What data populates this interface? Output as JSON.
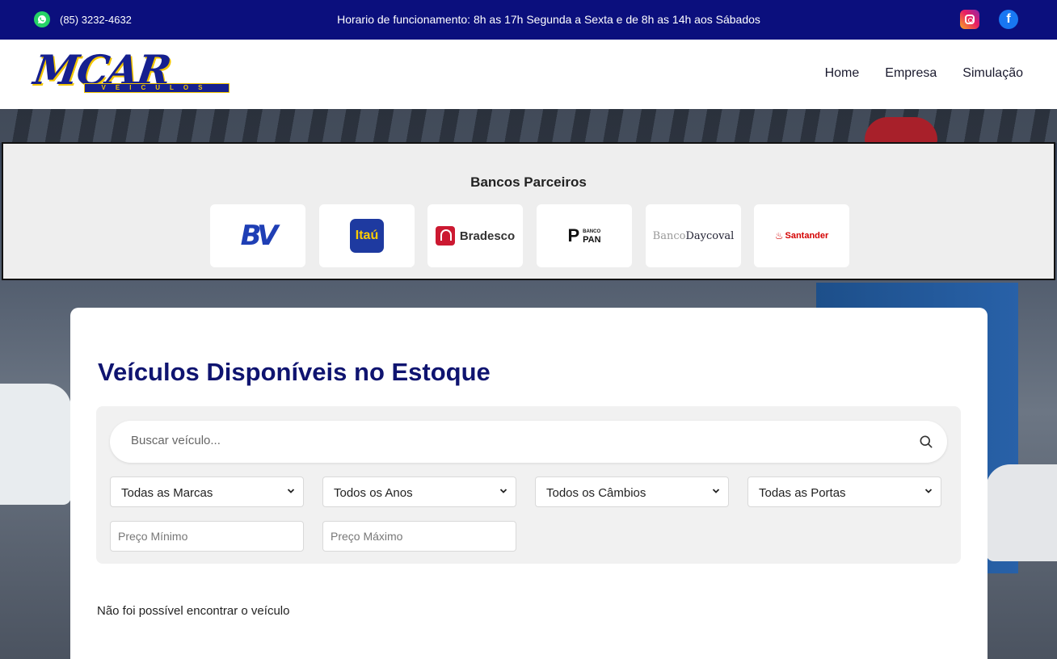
{
  "topbar": {
    "phone": "(85) 3232-4632",
    "hours": "Horario de funcionamento: 8h as 17h Segunda a Sexta e de 8h as 14h aos Sábados",
    "colors": {
      "background": "#0b0f7d",
      "whatsapp": "#25d366",
      "facebook": "#1877f2"
    },
    "icons": [
      "whatsapp-icon",
      "instagram-icon",
      "facebook-icon"
    ]
  },
  "header": {
    "logo": {
      "main": "MCAR",
      "sub": "VEICULOS"
    },
    "nav": [
      "Home",
      "Empresa",
      "Simulação"
    ]
  },
  "banks": {
    "title": "Bancos Parceiros",
    "items": [
      {
        "name": "BV",
        "logo": "bv-logo"
      },
      {
        "name": "Itaú",
        "logo": "itau-logo"
      },
      {
        "name": "Bradesco",
        "logo": "bradesco-logo"
      },
      {
        "name": "PAN",
        "prefix": "BANCO",
        "logo": "pan-logo"
      },
      {
        "name_light": "Banco",
        "name": "Daycoval",
        "logo": "daycoval-logo"
      },
      {
        "name": "Santander",
        "logo": "santander-logo"
      }
    ]
  },
  "stock": {
    "title": "Veículos Disponíveis no Estoque",
    "search": {
      "placeholder": "Buscar veículo...",
      "icon": "search-icon"
    },
    "selects": [
      {
        "value": "Todas as Marcas"
      },
      {
        "value": "Todos os Anos"
      },
      {
        "value": "Todos os Câmbios"
      },
      {
        "value": "Todas as Portas"
      }
    ],
    "price_min": {
      "placeholder": "Preço Mínimo"
    },
    "price_max": {
      "placeholder": "Preço Máximo"
    },
    "empty_message": "Não foi possível encontrar o veículo",
    "colors": {
      "title": "#0f1470",
      "panel": "#f1f1f1"
    }
  }
}
